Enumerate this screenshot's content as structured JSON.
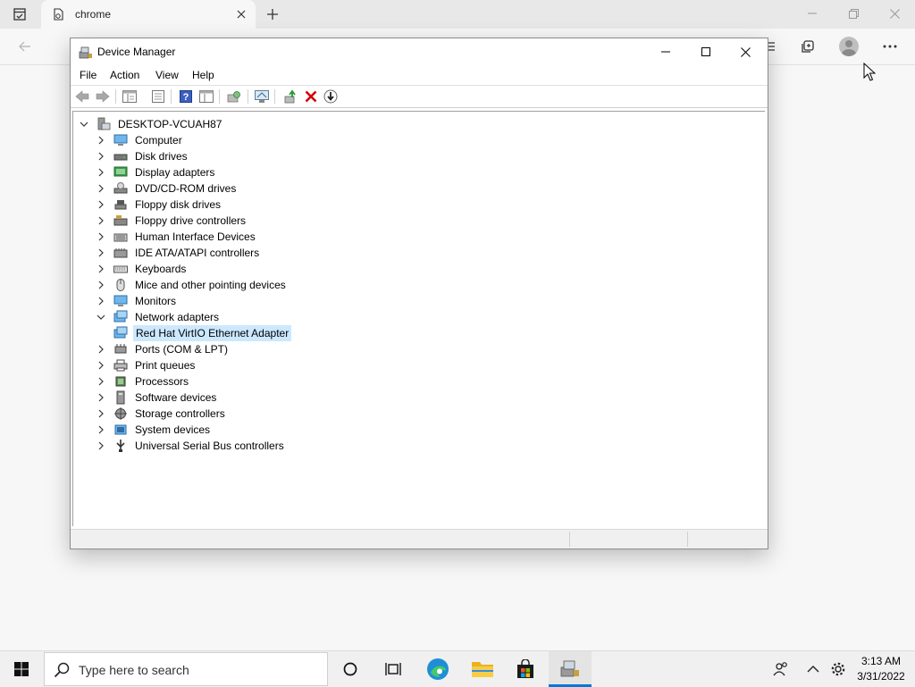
{
  "browser": {
    "tab_title": "chrome"
  },
  "device_manager": {
    "title": "Device Manager",
    "menu": [
      "File",
      "Action",
      "View",
      "Help"
    ],
    "toolbar": [
      "back-icon",
      "forward-icon",
      "show-hide-tree-icon",
      "properties-icon",
      "help-icon",
      "view-icon",
      "scan-changes-icon",
      "display-icon",
      "update-driver-icon",
      "uninstall-icon",
      "disable-icon"
    ],
    "tree": {
      "root": "DESKTOP-VCUAH87",
      "items": [
        {
          "label": "Computer",
          "icon": "computer-icon",
          "expanded": false
        },
        {
          "label": "Disk drives",
          "icon": "disk-drive-icon",
          "expanded": false
        },
        {
          "label": "Display adapters",
          "icon": "display-adapter-icon",
          "expanded": false
        },
        {
          "label": "DVD/CD-ROM drives",
          "icon": "dvd-drive-icon",
          "expanded": false
        },
        {
          "label": "Floppy disk drives",
          "icon": "floppy-disk-icon",
          "expanded": false
        },
        {
          "label": "Floppy drive controllers",
          "icon": "floppy-controller-icon",
          "expanded": false
        },
        {
          "label": "Human Interface Devices",
          "icon": "hid-icon",
          "expanded": false
        },
        {
          "label": "IDE ATA/ATAPI controllers",
          "icon": "ide-controller-icon",
          "expanded": false
        },
        {
          "label": "Keyboards",
          "icon": "keyboard-icon",
          "expanded": false
        },
        {
          "label": "Mice and other pointing devices",
          "icon": "mouse-icon",
          "expanded": false
        },
        {
          "label": "Monitors",
          "icon": "monitor-icon",
          "expanded": false
        },
        {
          "label": "Network adapters",
          "icon": "network-adapter-icon",
          "expanded": true
        },
        {
          "label": "Red Hat VirtIO Ethernet Adapter",
          "icon": "network-adapter-icon",
          "child": true,
          "selected": true
        },
        {
          "label": "Ports (COM & LPT)",
          "icon": "port-icon",
          "expanded": false
        },
        {
          "label": "Print queues",
          "icon": "printer-icon",
          "expanded": false
        },
        {
          "label": "Processors",
          "icon": "processor-icon",
          "expanded": false
        },
        {
          "label": "Software devices",
          "icon": "software-device-icon",
          "expanded": false
        },
        {
          "label": "Storage controllers",
          "icon": "storage-controller-icon",
          "expanded": false
        },
        {
          "label": "System devices",
          "icon": "system-device-icon",
          "expanded": false
        },
        {
          "label": "Universal Serial Bus controllers",
          "icon": "usb-icon",
          "expanded": false
        }
      ]
    }
  },
  "taskbar": {
    "search_placeholder": "Type here to search",
    "time": "3:13 AM",
    "date": "3/31/2022",
    "apps": [
      "start-icon",
      "search-icon",
      "cortana-icon",
      "task-view-icon",
      "edge-icon",
      "file-explorer-icon",
      "store-icon",
      "device-manager-icon"
    ]
  },
  "colors": {
    "selection": "#cce8ff",
    "accent": "#0078d4",
    "uninstall_red": "#d40000"
  }
}
